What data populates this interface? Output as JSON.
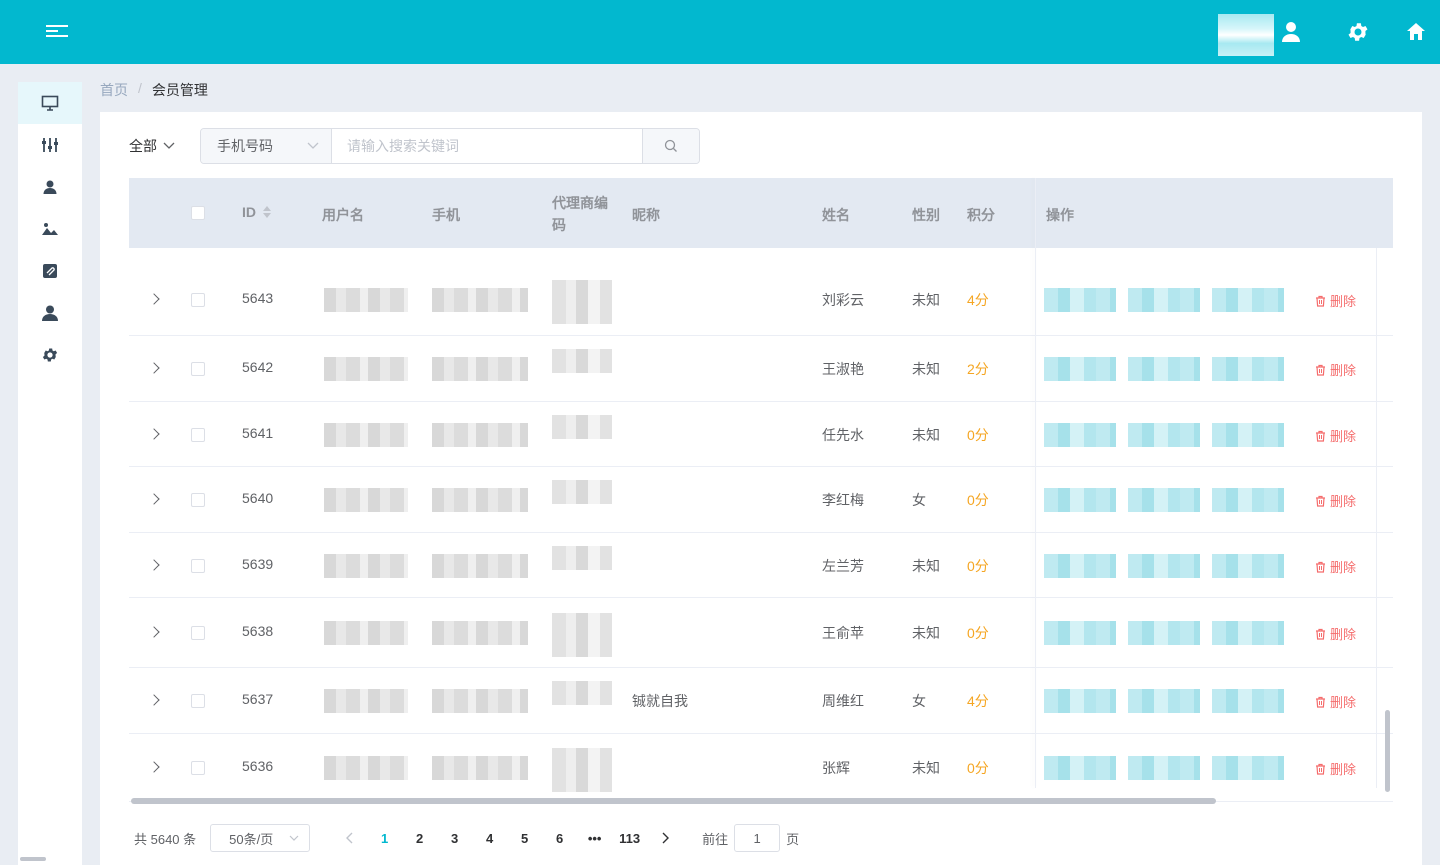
{
  "breadcrumb": {
    "home": "首页",
    "separator": "/",
    "current": "会员管理"
  },
  "filter": {
    "scope_label": "全部",
    "search_field": "手机号码",
    "search_placeholder": "请输入搜索关键词"
  },
  "table": {
    "columns": {
      "id": "ID",
      "username": "用户名",
      "phone": "手机",
      "agent_code_line1": "代理商编",
      "agent_code_line2": "码",
      "nickname": "昵称",
      "name": "姓名",
      "gender": "性别",
      "points": "积分",
      "actions": "操作"
    },
    "delete_label": "删除",
    "rows": [
      {
        "id": "5643",
        "nickname": "",
        "name": "刘彩云",
        "gender": "未知",
        "points": "4分"
      },
      {
        "id": "5642",
        "nickname": "",
        "name": "王淑艳",
        "gender": "未知",
        "points": "2分"
      },
      {
        "id": "5641",
        "nickname": "",
        "name": "任先水",
        "gender": "未知",
        "points": "0分"
      },
      {
        "id": "5640",
        "nickname": "",
        "name": "李红梅",
        "gender": "女",
        "points": "0分"
      },
      {
        "id": "5639",
        "nickname": "",
        "name": "左兰芳",
        "gender": "未知",
        "points": "0分"
      },
      {
        "id": "5638",
        "nickname": "",
        "name": "王俞苹",
        "gender": "未知",
        "points": "0分"
      },
      {
        "id": "5637",
        "nickname": "铖就自我",
        "name": "周维红",
        "gender": "女",
        "points": "4分"
      },
      {
        "id": "5636",
        "nickname": "",
        "name": "张辉",
        "gender": "未知",
        "points": "0分"
      }
    ]
  },
  "pagination": {
    "total": "共 5640 条",
    "page_size": "50条/页",
    "pages": [
      "1",
      "2",
      "3",
      "4",
      "5",
      "6",
      "•••",
      "113"
    ],
    "current": "1",
    "goto_label": "前往",
    "goto_value": "1",
    "page_suffix": "页"
  },
  "colors": {
    "header": "#02b8cf",
    "accent": "#02b8cf",
    "danger": "#f56c6c",
    "points": "#f5a623"
  }
}
